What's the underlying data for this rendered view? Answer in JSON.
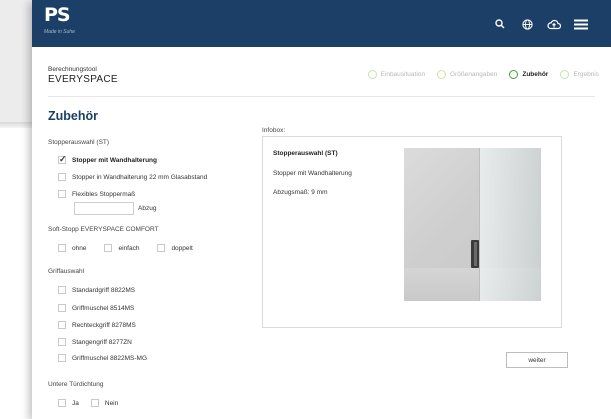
{
  "header": {
    "logo_mark": "PS",
    "logo_subtitle": "Made in Suhe",
    "icons": [
      "search-icon",
      "globe-icon",
      "cloud-upload-icon",
      "menu-icon"
    ]
  },
  "tool": {
    "label": "Berechnungstool",
    "name": "EVERYSPACE"
  },
  "steps": [
    {
      "label": "Einbausituation",
      "active": false
    },
    {
      "label": "Größenangaben",
      "active": false
    },
    {
      "label": "Zubehör",
      "active": true
    },
    {
      "label": "Ergebnis",
      "active": false
    }
  ],
  "page_title": "Zubehör",
  "stopper": {
    "heading": "Stopperauswahl (ST)",
    "options": [
      {
        "label": "Stopper mit Wandhalterung",
        "checked": true
      },
      {
        "label": "Stopper in Wandhalterung 22 mm Glasabstand",
        "checked": false
      },
      {
        "label": "Flexibles Stoppermaß",
        "checked": false
      }
    ],
    "abzug_value": "",
    "abzug_label": "Abzug"
  },
  "softstopp": {
    "heading": "Soft-Stopp EVERYSPACE COMFORT",
    "options": [
      {
        "label": "ohne",
        "checked": false
      },
      {
        "label": "einfach",
        "checked": false
      },
      {
        "label": "doppelt",
        "checked": false
      }
    ]
  },
  "griff": {
    "heading": "Griffauswahl",
    "options": [
      {
        "label": "Standardgriff 8822MS",
        "checked": false
      },
      {
        "label": "Griffmuschel 8514MS",
        "checked": false
      },
      {
        "label": "Rechteckgriff 8278MS",
        "checked": false
      },
      {
        "label": "Stangengriff 8277ZN",
        "checked": false
      },
      {
        "label": "Griffmuschel 8822MS-MG",
        "checked": false
      }
    ]
  },
  "dichtung": {
    "heading": "Untere Türdichtung",
    "options": [
      {
        "label": "Ja",
        "checked": false
      },
      {
        "label": "Nein",
        "checked": false
      }
    ]
  },
  "infobox": {
    "label": "Infobox:",
    "title": "Stopperauswahl (ST)",
    "line1": "Stopper mit Wandhalterung",
    "line2": "Abzugsmaß: 9 mm"
  },
  "buttons": {
    "next": "weiter"
  },
  "colors": {
    "header_bg": "#1b3f66",
    "title": "#1b3f66",
    "step_active": "#4a9a2f",
    "step_inactive": "#c8e2a8"
  }
}
